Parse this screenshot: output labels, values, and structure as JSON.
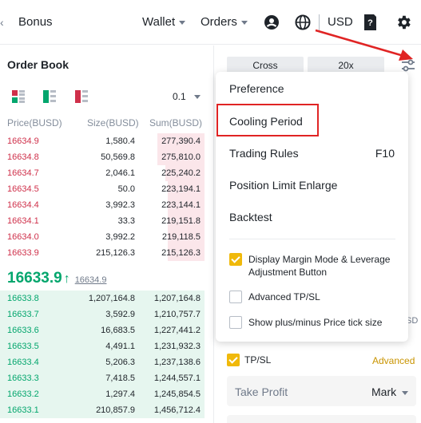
{
  "topnav": {
    "bonus": "Bonus",
    "wallet": "Wallet",
    "orders": "Orders",
    "currency": "USD",
    "icons": [
      "user-icon",
      "globe-icon",
      "document-icon",
      "settings-gear-icon"
    ]
  },
  "order_book": {
    "title": "Order Book",
    "step": "0.1",
    "headers": {
      "price": "Price(BUSD)",
      "size": "Size(BUSD)",
      "sum": "Sum(BUSD)"
    },
    "asks": [
      {
        "price": "16634.9",
        "size": "1,580.4",
        "sum": "277,390.4",
        "depth": 0.23
      },
      {
        "price": "16634.8",
        "size": "50,569.8",
        "sum": "275,810.0",
        "depth": 0.23
      },
      {
        "price": "16634.7",
        "size": "2,046.1",
        "sum": "225,240.2",
        "depth": 0.19
      },
      {
        "price": "16634.5",
        "size": "50.0",
        "sum": "223,194.1",
        "depth": 0.18
      },
      {
        "price": "16634.4",
        "size": "3,992.3",
        "sum": "223,144.1",
        "depth": 0.18
      },
      {
        "price": "16634.1",
        "size": "33.3",
        "sum": "219,151.8",
        "depth": 0.18
      },
      {
        "price": "16634.0",
        "size": "3,992.2",
        "sum": "219,118.5",
        "depth": 0.18
      },
      {
        "price": "16633.9",
        "size": "215,126.3",
        "sum": "215,126.3",
        "depth": 0.18
      }
    ],
    "last_price": "16633.9",
    "mark_price": "16634.9",
    "bids": [
      {
        "price": "16633.8",
        "size": "1,207,164.8",
        "sum": "1,207,164.8",
        "depth": 1.0
      },
      {
        "price": "16633.7",
        "size": "3,592.9",
        "sum": "1,210,757.7",
        "depth": 1.0
      },
      {
        "price": "16633.6",
        "size": "16,683.5",
        "sum": "1,227,441.2",
        "depth": 1.0
      },
      {
        "price": "16633.5",
        "size": "4,491.1",
        "sum": "1,231,932.3",
        "depth": 1.0
      },
      {
        "price": "16633.4",
        "size": "5,206.3",
        "sum": "1,237,138.6",
        "depth": 1.0
      },
      {
        "price": "16633.3",
        "size": "7,418.5",
        "sum": "1,244,557.1",
        "depth": 1.0
      },
      {
        "price": "16633.2",
        "size": "1,297.4",
        "sum": "1,245,854.5",
        "depth": 1.0
      },
      {
        "price": "16633.1",
        "size": "210,857.9",
        "sum": "1,456,712.4",
        "depth": 1.0
      }
    ]
  },
  "trade_panel": {
    "margin_mode": "Cross",
    "leverage": "20x",
    "tpsl_label": "TP/SL",
    "tpsl_checked": true,
    "advanced": "Advanced",
    "take_profit_placeholder": "Take Profit",
    "take_profit_trigger": "Mark",
    "edge_fragment": "SD"
  },
  "menu": {
    "items": [
      {
        "label": "Preference",
        "shortcut": ""
      },
      {
        "label": "Cooling Period",
        "shortcut": ""
      },
      {
        "label": "Trading Rules",
        "shortcut": "F10"
      },
      {
        "label": "Position Limit Enlarge",
        "shortcut": ""
      },
      {
        "label": "Backtest",
        "shortcut": ""
      }
    ],
    "checkboxes": [
      {
        "label": "Display Margin Mode & Leverage Adjustment Button",
        "checked": true
      },
      {
        "label": "Advanced TP/SL",
        "checked": false
      },
      {
        "label": "Show plus/minus Price tick size",
        "checked": false
      }
    ]
  },
  "colors": {
    "ask": "#cf304a",
    "bid": "#03a66d",
    "accent": "#f0b90b",
    "highlight": "#e02424"
  }
}
